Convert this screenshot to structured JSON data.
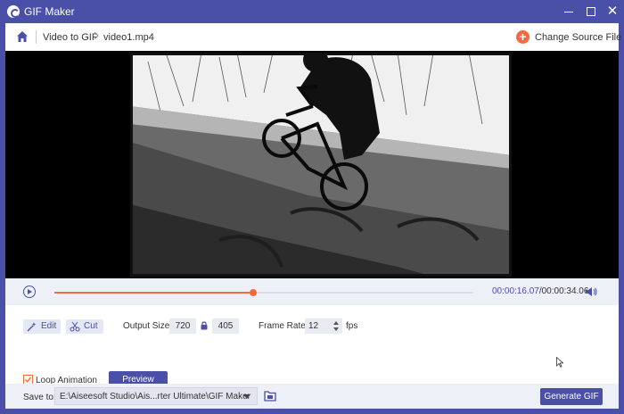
{
  "window": {
    "title": "GIF Maker",
    "controls": {
      "minimize_icon": "minimize-icon",
      "maximize_icon": "maximize-icon",
      "close_icon": "close-icon",
      "close_glyph": "✕"
    }
  },
  "header": {
    "home_icon": "home-icon",
    "breadcrumb": [
      "Video to GIF",
      "video1.mp4"
    ],
    "change_source_label": "Change Source File",
    "change_source_glyph": "+"
  },
  "video": {
    "description_icon": "video-preview"
  },
  "player": {
    "progress_fraction": 0.4749,
    "current_time": "00:00:16.07",
    "total_time": "/00:00:34.06"
  },
  "settings": {
    "edit_label": "Edit",
    "cut_label": "Cut",
    "output_size_label": "Output Size:",
    "width": "720",
    "height": "405",
    "frame_rate_label": "Frame Rate:",
    "frame_rate": "12",
    "fps_label": "fps",
    "loop_label": "Loop Animation",
    "loop_checked": true,
    "preview_label": "Preview"
  },
  "footer": {
    "save_to_label": "Save to:",
    "save_path": "E:\\Aiseesoft Studio\\Ais...rter Ultimate\\GIF Maker",
    "generate_label": "Generate GIF"
  },
  "colors": {
    "accent": "#4a4fa8",
    "orange": "#f26a3e",
    "panel_bg": "#eef0f8"
  }
}
